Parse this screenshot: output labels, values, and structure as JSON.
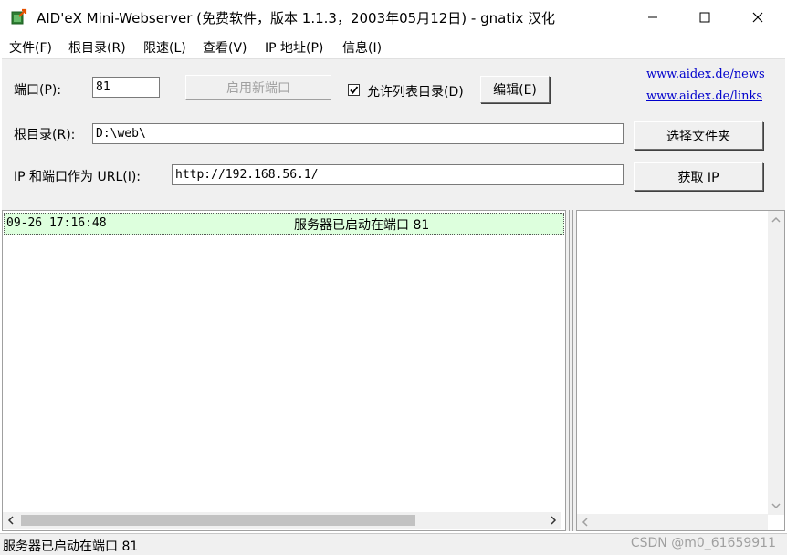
{
  "window": {
    "title": "AID'eX Mini-Webserver (免费软件，版本 1.1.3，2003年05月12日) - gnatix 汉化",
    "minimize": "—",
    "maximize": "☐",
    "close": "✕"
  },
  "menu": [
    {
      "label": "文件(F)"
    },
    {
      "label": "根目录(R)"
    },
    {
      "label": "限速(L)"
    },
    {
      "label": "查看(V)"
    },
    {
      "label": "IP 地址(P)"
    },
    {
      "label": "信息(I)"
    }
  ],
  "toolbar": {
    "port_label": "端口(P):",
    "port_value": "81",
    "start_new_port_button": "启用新端口",
    "allow_list_label": "允许列表目录(D)",
    "allow_list_checked": true,
    "edit_button": "编辑(E)",
    "link_news": "www.aidex.de/news",
    "link_links": "www.aidex.de/links",
    "root_label": "根目录(R):",
    "root_value": "D:\\web\\",
    "select_folder_button": "选择文件夹",
    "url_label": "IP 和端口作为 URL(I):",
    "url_value": "http://192.168.56.1/",
    "get_ip_button": "获取 IP"
  },
  "log": {
    "rows": [
      {
        "time": "09-26 17:16:48",
        "message": "服务器已启动在端口 81"
      }
    ]
  },
  "status": {
    "text": "服务器已启动在端口 81",
    "watermark": "CSDN @m0_61659911"
  },
  "colors": {
    "log_highlight": "#ddffdd",
    "link": "#0000cc",
    "panel_bg": "#f0f0f0"
  }
}
